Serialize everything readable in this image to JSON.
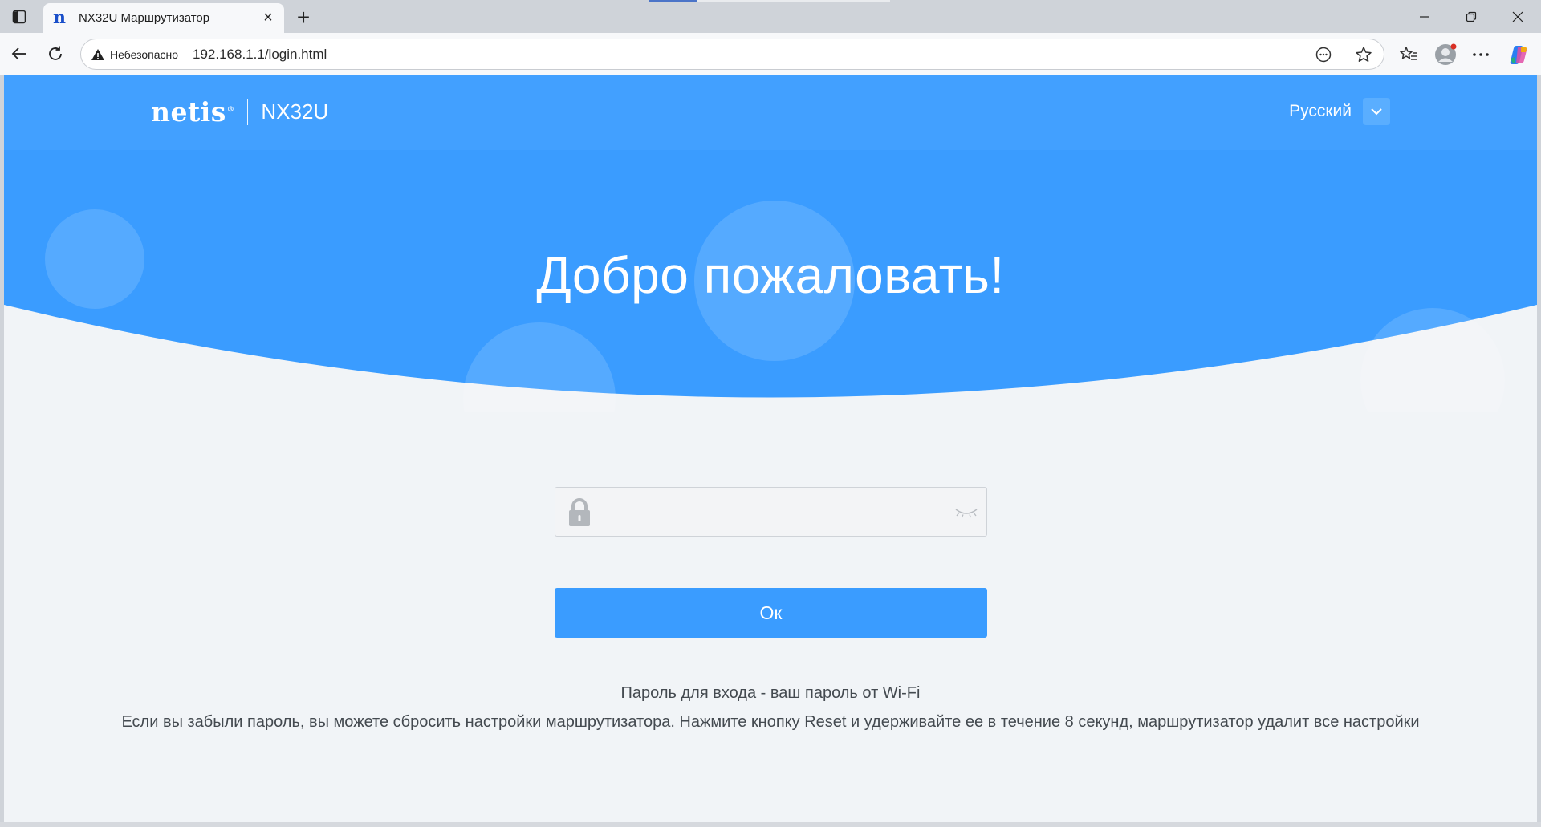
{
  "browser": {
    "tab_title": "NX32U Маршрутизатор",
    "tab_favicon_letter": "n",
    "security_label": "Небезопасно",
    "url": "192.168.1.1/login.html"
  },
  "header": {
    "brand_logo": "netis",
    "brand_reg": "®",
    "model": "NX32U",
    "language": "Русский"
  },
  "hero": {
    "welcome": "Добро пожаловать!"
  },
  "login": {
    "password_value": "",
    "password_placeholder": "",
    "ok_label": "Ок"
  },
  "hints": {
    "line1": "Пароль для входа - ваш пароль от Wi-Fi",
    "line2": "Если вы забыли пароль, вы можете сбросить настройки маршрутизатора. Нажмите кнопку Reset и удерживайте ее в течение 8 секунд, маршрутизатор удалит все настройки"
  },
  "colors": {
    "brand_blue": "#42a0ff",
    "hero_blue": "#3a9cff",
    "page_bg": "#f1f4f7"
  },
  "icons": {
    "sidebar": "sidebar-toggle-icon",
    "close": "close-icon",
    "new_tab": "plus-icon",
    "back": "back-arrow-icon",
    "refresh": "refresh-icon",
    "warning": "warning-icon",
    "lock": "lock-icon",
    "eye": "eye-closed-icon",
    "dropdown": "chevron-down-icon"
  }
}
